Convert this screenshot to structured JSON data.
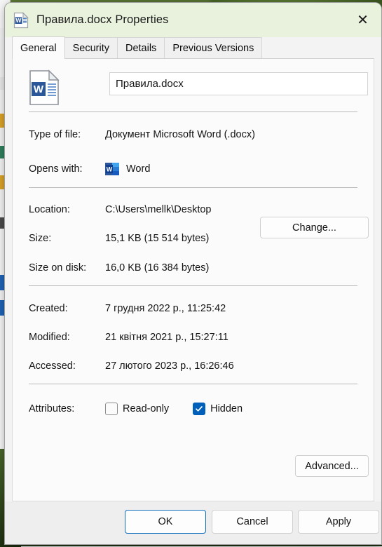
{
  "window": {
    "title": "Правила.docx Properties",
    "icon": "word-document-icon",
    "close_label": "✕",
    "titlebar_color": "#e9f2dd"
  },
  "tabs": [
    {
      "label": "General",
      "active": true
    },
    {
      "label": "Security",
      "active": false
    },
    {
      "label": "Details",
      "active": false
    },
    {
      "label": "Previous Versions",
      "active": false
    }
  ],
  "general": {
    "file_icon": "word-document-icon",
    "filename_value": "Правила.docx",
    "filename_placeholder": "",
    "rows": [
      {
        "label": "Type of file:",
        "value": "Документ Microsoft Word (.docx)"
      },
      {
        "label": "Opens with:",
        "value": "Word"
      },
      {
        "label": "Location:",
        "value": "C:\\Users\\mellk\\Desktop"
      },
      {
        "label": "Size:",
        "value": "15,1 KB (15 514 bytes)"
      },
      {
        "label": "Size on disk:",
        "value": "16,0 KB (16 384 bytes)"
      },
      {
        "label": "Created:",
        "value": "7 грудня 2022 р., 11:25:42"
      },
      {
        "label": "Modified:",
        "value": "21 квітня 2021 р., 15:27:11"
      },
      {
        "label": "Accessed:",
        "value": "27 лютого 2023 р., 16:26:46"
      },
      {
        "label": "Attributes:",
        "value": ""
      }
    ],
    "change_button": "Change...",
    "opens_with_icon": "word-app-icon",
    "attributes": {
      "label": "Attributes:",
      "readonly": {
        "label": "Read-only",
        "checked": false
      },
      "hidden": {
        "label": "Hidden",
        "checked": true
      },
      "advanced_button": "Advanced..."
    }
  },
  "footer": {
    "ok": "OK",
    "cancel": "Cancel",
    "apply": "Apply"
  },
  "colors": {
    "accent": "#005fb8",
    "focus_border": "#0f6cbd",
    "word_blue": "#2b579a",
    "titlebar": "#e9f2dd"
  }
}
